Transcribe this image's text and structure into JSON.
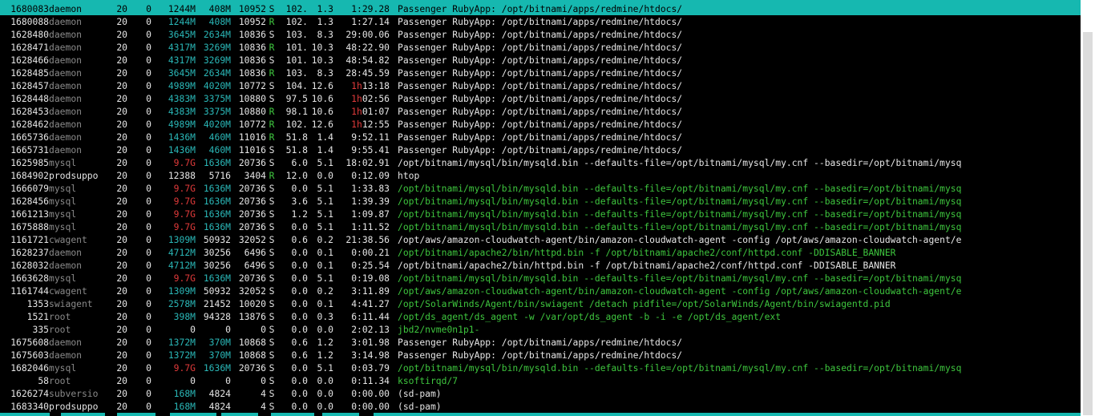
{
  "rows": [
    {
      "pid": "1680083",
      "user": "daemon",
      "pri": "20",
      "ni": "0",
      "virt": "1244M",
      "res": "408M",
      "shr": "10952",
      "s": "S",
      "cpu": "102.",
      "mem": "1.3",
      "time": "1:29.28",
      "cmd": "Passenger RubyApp: /opt/bitnami/apps/redmine/htdocs/",
      "selected": true
    },
    {
      "pid": "1680088",
      "user": "daemon",
      "pri": "20",
      "ni": "0",
      "virt": "1244M",
      "res": "408M",
      "shr": "10952",
      "s": "R",
      "cpu": "102.",
      "mem": "1.3",
      "time": "1:27.14",
      "cmd": "Passenger RubyApp: /opt/bitnami/apps/redmine/htdocs/"
    },
    {
      "pid": "1628480",
      "user": "daemon",
      "pri": "20",
      "ni": "0",
      "virt": "3645M",
      "res": "2634M",
      "shr": "10836",
      "s": "S",
      "cpu": "103.",
      "mem": "8.3",
      "time": "29:00.06",
      "cmd": "Passenger RubyApp: /opt/bitnami/apps/redmine/htdocs/"
    },
    {
      "pid": "1628471",
      "user": "daemon",
      "pri": "20",
      "ni": "0",
      "virt": "4317M",
      "res": "3269M",
      "shr": "10836",
      "s": "R",
      "cpu": "101.",
      "mem": "10.3",
      "time": "48:22.90",
      "cmd": "Passenger RubyApp: /opt/bitnami/apps/redmine/htdocs/"
    },
    {
      "pid": "1628466",
      "user": "daemon",
      "pri": "20",
      "ni": "0",
      "virt": "4317M",
      "res": "3269M",
      "shr": "10836",
      "s": "S",
      "cpu": "101.",
      "mem": "10.3",
      "time": "48:54.82",
      "cmd": "Passenger RubyApp: /opt/bitnami/apps/redmine/htdocs/"
    },
    {
      "pid": "1628485",
      "user": "daemon",
      "pri": "20",
      "ni": "0",
      "virt": "3645M",
      "res": "2634M",
      "shr": "10836",
      "s": "R",
      "cpu": "103.",
      "mem": "8.3",
      "time": "28:45.59",
      "cmd": "Passenger RubyApp: /opt/bitnami/apps/redmine/htdocs/"
    },
    {
      "pid": "1628457",
      "user": "daemon",
      "pri": "20",
      "ni": "0",
      "virt": "4989M",
      "res": "4020M",
      "shr": "10772",
      "s": "S",
      "cpu": "104.",
      "mem": "12.6",
      "time": "1h13:18",
      "cmd": "Passenger RubyApp: /opt/bitnami/apps/redmine/htdocs/"
    },
    {
      "pid": "1628448",
      "user": "daemon",
      "pri": "20",
      "ni": "0",
      "virt": "4383M",
      "res": "3375M",
      "shr": "10880",
      "s": "S",
      "cpu": "97.5",
      "mem": "10.6",
      "time": "1h02:56",
      "cmd": "Passenger RubyApp: /opt/bitnami/apps/redmine/htdocs/"
    },
    {
      "pid": "1628453",
      "user": "daemon",
      "pri": "20",
      "ni": "0",
      "virt": "4383M",
      "res": "3375M",
      "shr": "10880",
      "s": "R",
      "cpu": "98.1",
      "mem": "10.6",
      "time": "1h01:07",
      "cmd": "Passenger RubyApp: /opt/bitnami/apps/redmine/htdocs/"
    },
    {
      "pid": "1628462",
      "user": "daemon",
      "pri": "20",
      "ni": "0",
      "virt": "4989M",
      "res": "4020M",
      "shr": "10772",
      "s": "R",
      "cpu": "102.",
      "mem": "12.6",
      "time": "1h12:55",
      "cmd": "Passenger RubyApp: /opt/bitnami/apps/redmine/htdocs/"
    },
    {
      "pid": "1665736",
      "user": "daemon",
      "pri": "20",
      "ni": "0",
      "virt": "1436M",
      "res": "460M",
      "shr": "11016",
      "s": "R",
      "cpu": "51.8",
      "mem": "1.4",
      "time": "9:52.11",
      "cmd": "Passenger RubyApp: /opt/bitnami/apps/redmine/htdocs/"
    },
    {
      "pid": "1665731",
      "user": "daemon",
      "pri": "20",
      "ni": "0",
      "virt": "1436M",
      "res": "460M",
      "shr": "11016",
      "s": "S",
      "cpu": "51.8",
      "mem": "1.4",
      "time": "9:55.41",
      "cmd": "Passenger RubyApp: /opt/bitnami/apps/redmine/htdocs/"
    },
    {
      "pid": "1625985",
      "user": "mysql",
      "pri": "20",
      "ni": "0",
      "virt": "9.7G",
      "res": "1636M",
      "shr": "20736",
      "s": "S",
      "cpu": "6.0",
      "mem": "5.1",
      "time": "18:02.91",
      "cmd": "/opt/bitnami/mysql/bin/mysqld.bin --defaults-file=/opt/bitnami/mysql/my.cnf --basedir=/opt/bitnami/mysq"
    },
    {
      "pid": "1684902",
      "user": "prodsuppo",
      "pri": "20",
      "ni": "0",
      "virt": "12388",
      "res": "5716",
      "shr": "3404",
      "s": "R",
      "cpu": "12.0",
      "mem": "0.0",
      "time": "0:12.09",
      "cmd": "htop"
    },
    {
      "pid": "1666079",
      "user": "mysql",
      "pri": "20",
      "ni": "0",
      "virt": "9.7G",
      "res": "1636M",
      "shr": "20736",
      "s": "S",
      "cpu": "0.0",
      "mem": "5.1",
      "time": "1:33.83",
      "cmd": "/opt/bitnami/mysql/bin/mysqld.bin --defaults-file=/opt/bitnami/mysql/my.cnf --basedir=/opt/bitnami/mysq"
    },
    {
      "pid": "1628456",
      "user": "mysql",
      "pri": "20",
      "ni": "0",
      "virt": "9.7G",
      "res": "1636M",
      "shr": "20736",
      "s": "S",
      "cpu": "3.6",
      "mem": "5.1",
      "time": "1:39.39",
      "cmd": "/opt/bitnami/mysql/bin/mysqld.bin --defaults-file=/opt/bitnami/mysql/my.cnf --basedir=/opt/bitnami/mysq"
    },
    {
      "pid": "1661213",
      "user": "mysql",
      "pri": "20",
      "ni": "0",
      "virt": "9.7G",
      "res": "1636M",
      "shr": "20736",
      "s": "S",
      "cpu": "1.2",
      "mem": "5.1",
      "time": "1:09.87",
      "cmd": "/opt/bitnami/mysql/bin/mysqld.bin --defaults-file=/opt/bitnami/mysql/my.cnf --basedir=/opt/bitnami/mysq"
    },
    {
      "pid": "1675888",
      "user": "mysql",
      "pri": "20",
      "ni": "0",
      "virt": "9.7G",
      "res": "1636M",
      "shr": "20736",
      "s": "S",
      "cpu": "0.0",
      "mem": "5.1",
      "time": "1:11.52",
      "cmd": "/opt/bitnami/mysql/bin/mysqld.bin --defaults-file=/opt/bitnami/mysql/my.cnf --basedir=/opt/bitnami/mysq"
    },
    {
      "pid": "1161721",
      "user": "cwagent",
      "pri": "20",
      "ni": "0",
      "virt": "1309M",
      "res": "50932",
      "shr": "32052",
      "s": "S",
      "cpu": "0.6",
      "mem": "0.2",
      "time": "21:38.56",
      "cmd": "/opt/aws/amazon-cloudwatch-agent/bin/amazon-cloudwatch-agent -config /opt/aws/amazon-cloudwatch-agent/e"
    },
    {
      "pid": "1628237",
      "user": "daemon",
      "pri": "20",
      "ni": "0",
      "virt": "4712M",
      "res": "30256",
      "shr": "6496",
      "s": "S",
      "cpu": "0.0",
      "mem": "0.1",
      "time": "0:00.21",
      "cmd": "/opt/bitnami/apache2/bin/httpd.bin -f /opt/bitnami/apache2/conf/httpd.conf -DDISABLE_BANNER"
    },
    {
      "pid": "1628032",
      "user": "daemon",
      "pri": "20",
      "ni": "0",
      "virt": "4712M",
      "res": "30256",
      "shr": "6496",
      "s": "S",
      "cpu": "0.0",
      "mem": "0.1",
      "time": "0:25.54",
      "cmd": "/opt/bitnami/apache2/bin/httpd.bin -f /opt/bitnami/apache2/conf/httpd.conf -DDISABLE_BANNER"
    },
    {
      "pid": "1663628",
      "user": "mysql",
      "pri": "20",
      "ni": "0",
      "virt": "9.7G",
      "res": "1636M",
      "shr": "20736",
      "s": "S",
      "cpu": "0.0",
      "mem": "5.1",
      "time": "0:19.08",
      "cmd": "/opt/bitnami/mysql/bin/mysqld.bin --defaults-file=/opt/bitnami/mysql/my.cnf --basedir=/opt/bitnami/mysq"
    },
    {
      "pid": "1161744",
      "user": "cwagent",
      "pri": "20",
      "ni": "0",
      "virt": "1309M",
      "res": "50932",
      "shr": "32052",
      "s": "S",
      "cpu": "0.0",
      "mem": "0.2",
      "time": "3:11.89",
      "cmd": "/opt/aws/amazon-cloudwatch-agent/bin/amazon-cloudwatch-agent -config /opt/aws/amazon-cloudwatch-agent/e"
    },
    {
      "pid": "1353",
      "user": "swiagent",
      "pri": "20",
      "ni": "0",
      "virt": "2578M",
      "res": "21452",
      "shr": "10020",
      "s": "S",
      "cpu": "0.0",
      "mem": "0.1",
      "time": "4:41.27",
      "cmd": "/opt/SolarWinds/Agent/bin/swiagent /detach pidfile=/opt/SolarWinds/Agent/bin/swiagentd.pid"
    },
    {
      "pid": "1521",
      "user": "root",
      "pri": "20",
      "ni": "0",
      "virt": "398M",
      "res": "94328",
      "shr": "13876",
      "s": "S",
      "cpu": "0.0",
      "mem": "0.3",
      "time": "6:11.44",
      "cmd": "/opt/ds_agent/ds_agent -w /var/opt/ds_agent -b -i -e /opt/ds_agent/ext"
    },
    {
      "pid": "335",
      "user": "root",
      "pri": "20",
      "ni": "0",
      "virt": "0",
      "res": "0",
      "shr": "0",
      "s": "S",
      "cpu": "0.0",
      "mem": "0.0",
      "time": "2:02.13",
      "cmd": "jbd2/nvme0n1p1-"
    },
    {
      "pid": "1675608",
      "user": "daemon",
      "pri": "20",
      "ni": "0",
      "virt": "1372M",
      "res": "370M",
      "shr": "10868",
      "s": "S",
      "cpu": "0.6",
      "mem": "1.2",
      "time": "3:01.98",
      "cmd": "Passenger RubyApp: /opt/bitnami/apps/redmine/htdocs/"
    },
    {
      "pid": "1675603",
      "user": "daemon",
      "pri": "20",
      "ni": "0",
      "virt": "1372M",
      "res": "370M",
      "shr": "10868",
      "s": "S",
      "cpu": "0.6",
      "mem": "1.2",
      "time": "3:14.98",
      "cmd": "Passenger RubyApp: /opt/bitnami/apps/redmine/htdocs/"
    },
    {
      "pid": "1682046",
      "user": "mysql",
      "pri": "20",
      "ni": "0",
      "virt": "9.7G",
      "res": "1636M",
      "shr": "20736",
      "s": "S",
      "cpu": "0.0",
      "mem": "5.1",
      "time": "0:03.79",
      "cmd": "/opt/bitnami/mysql/bin/mysqld.bin --defaults-file=/opt/bitnami/mysql/my.cnf --basedir=/opt/bitnami/mysq"
    },
    {
      "pid": "58",
      "user": "root",
      "pri": "20",
      "ni": "0",
      "virt": "0",
      "res": "0",
      "shr": "0",
      "s": "S",
      "cpu": "0.0",
      "mem": "0.0",
      "time": "0:11.34",
      "cmd": "ksoftirqd/7"
    },
    {
      "pid": "1626274",
      "user": "subversio",
      "pri": "20",
      "ni": "0",
      "virt": "168M",
      "res": "4824",
      "shr": "4",
      "s": "S",
      "cpu": "0.0",
      "mem": "0.0",
      "time": "0:00.00",
      "cmd": "(sd-pam)"
    },
    {
      "pid": "1683340",
      "user": "prodsuppo",
      "pri": "20",
      "ni": "0",
      "virt": "168M",
      "res": "4824",
      "shr": "4",
      "s": "S",
      "cpu": "0.0",
      "mem": "0.0",
      "time": "0:00.00",
      "cmd": "(sd-pam)"
    }
  ],
  "colors": {
    "selection": "#16b8b0",
    "background": "#000000",
    "text": "#d6d6d6",
    "dim": "#8a8a8a",
    "cyan": "#2ab7b7",
    "green": "#3ec63e",
    "red": "#e03a3a"
  }
}
